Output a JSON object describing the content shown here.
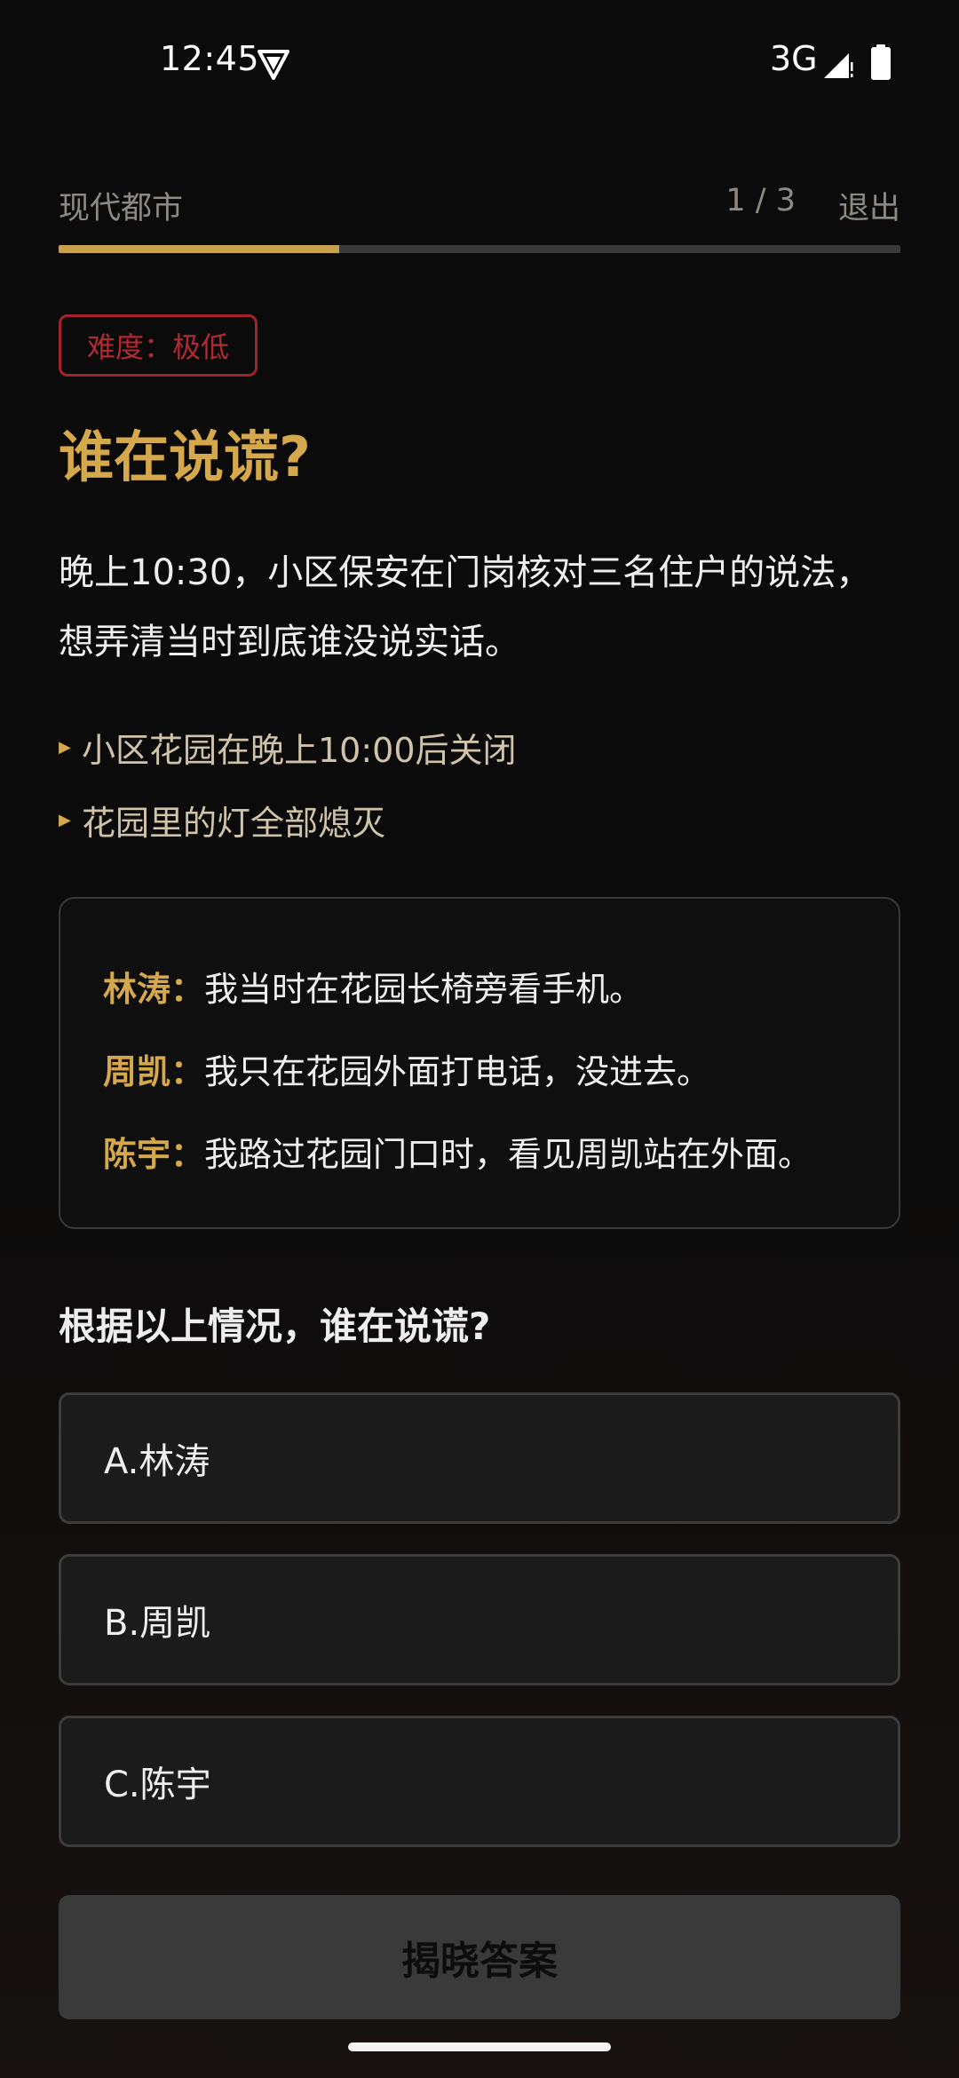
{
  "status_bar": {
    "time": "12:45",
    "network": "3G",
    "icons": [
      "vpn-shield-icon",
      "signal-icon",
      "battery-icon"
    ]
  },
  "header": {
    "category": "现代都市",
    "progress_text": "1 / 3",
    "exit_label": "退出",
    "progress_fraction": 0.333
  },
  "puzzle": {
    "difficulty": "难度：极低",
    "title": "谁在说谎?",
    "scenario": "晚上10:30，小区保安在门岗核对三名住户的说法，想弄清当时到底谁没说实话。",
    "clues": [
      "小区花园在晚上10:00后关闭",
      "花园里的灯全部熄灭"
    ],
    "statements": [
      {
        "speaker": "林涛：",
        "text": "我当时在花园长椅旁看手机。"
      },
      {
        "speaker": "周凯：",
        "text": "我只在花园外面打电话，没进去。"
      },
      {
        "speaker": "陈宇：",
        "text": "我路过花园门口时，看见周凯站在外面。"
      }
    ],
    "question": "根据以上情况，谁在说谎?",
    "options": [
      "A.林涛",
      "B.周凯",
      "C.陈宇"
    ],
    "reveal_label": "揭晓答案"
  },
  "colors": {
    "accent_gold": "#d4a84b",
    "badge_red": "#b02a32",
    "background": "#0b0b0c"
  }
}
